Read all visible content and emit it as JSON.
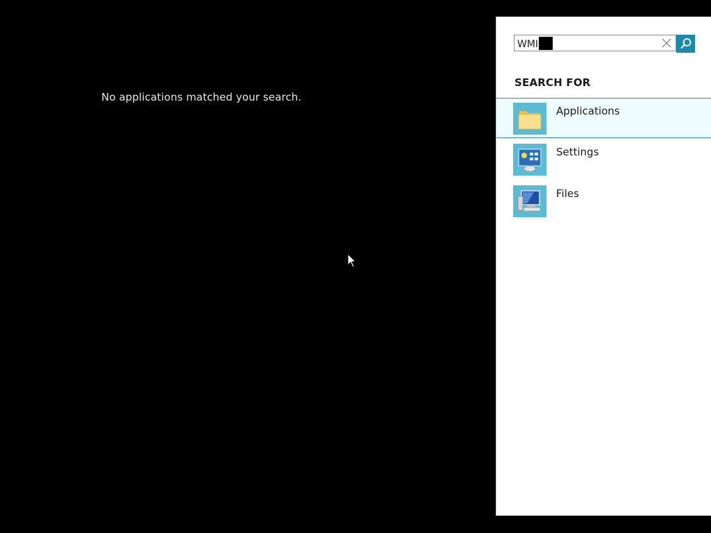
{
  "desktop": {
    "message": "No applications matched your search."
  },
  "search": {
    "query": "WMI",
    "clear_icon": "close-icon",
    "submit_icon": "search-icon",
    "accent_color": "#1b8aab"
  },
  "search_for": {
    "title": "SEARCH FOR",
    "selected_index": 0,
    "categories": [
      {
        "label": "Applications",
        "icon": "folder-icon"
      },
      {
        "label": "Settings",
        "icon": "control-panel-icon"
      },
      {
        "label": "Files",
        "icon": "computer-files-icon"
      }
    ]
  }
}
